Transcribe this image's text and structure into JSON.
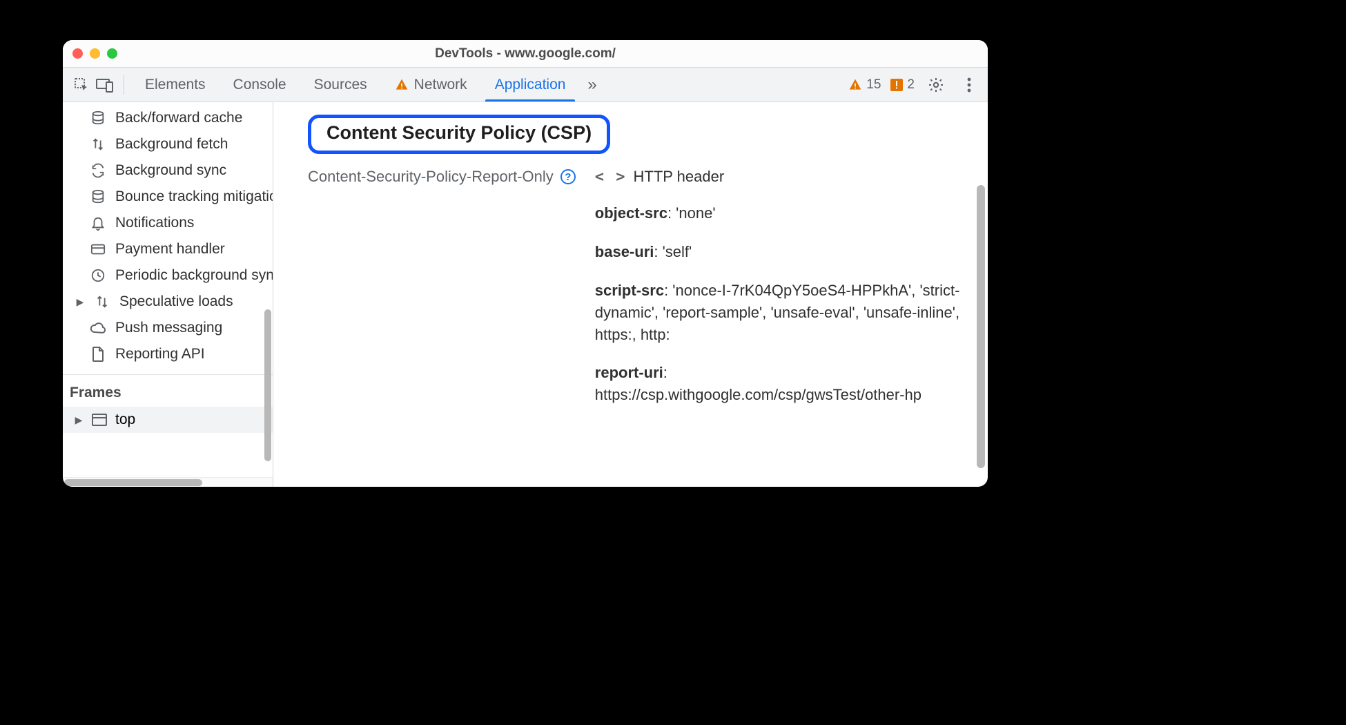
{
  "window": {
    "title": "DevTools - www.google.com/"
  },
  "toolbar": {
    "tabs": [
      {
        "label": "Elements",
        "warn": false,
        "active": false
      },
      {
        "label": "Console",
        "warn": false,
        "active": false
      },
      {
        "label": "Sources",
        "warn": false,
        "active": false
      },
      {
        "label": "Network",
        "warn": true,
        "active": false
      },
      {
        "label": "Application",
        "warn": false,
        "active": true
      }
    ],
    "overflow_glyph": "»",
    "warnings_count": "15",
    "issues_count": "2"
  },
  "sidebar": {
    "items": [
      {
        "icon": "database",
        "label": "Back/forward cache",
        "arrow": false
      },
      {
        "icon": "bgfetch",
        "label": "Background fetch",
        "arrow": false
      },
      {
        "icon": "sync",
        "label": "Background sync",
        "arrow": false
      },
      {
        "icon": "database",
        "label": "Bounce tracking mitigations",
        "arrow": false
      },
      {
        "icon": "bell",
        "label": "Notifications",
        "arrow": false
      },
      {
        "icon": "card",
        "label": "Payment handler",
        "arrow": false
      },
      {
        "icon": "clock",
        "label": "Periodic background sync",
        "arrow": false
      },
      {
        "icon": "bgfetch",
        "label": "Speculative loads",
        "arrow": true
      },
      {
        "icon": "cloud",
        "label": "Push messaging",
        "arrow": false
      },
      {
        "icon": "doc",
        "label": "Reporting API",
        "arrow": false
      }
    ],
    "frames_heading": "Frames",
    "frames_top": "top"
  },
  "main": {
    "csp_heading": "Content Security Policy (CSP)",
    "header_name": "Content-Security-Policy-Report-Only",
    "source_label": "HTTP header",
    "directives": [
      {
        "name": "object-src",
        "value": "'none'"
      },
      {
        "name": "base-uri",
        "value": "'self'"
      },
      {
        "name": "script-src",
        "value": "'nonce-I-7rK04QpY5oeS4-HPPkhA', 'strict-dynamic', 'report-sample', 'unsafe-eval', 'unsafe-inline', https:, http:"
      },
      {
        "name": "report-uri",
        "value": "https://csp.withgoogle.com/csp/gwsTest/other-hp"
      }
    ]
  }
}
